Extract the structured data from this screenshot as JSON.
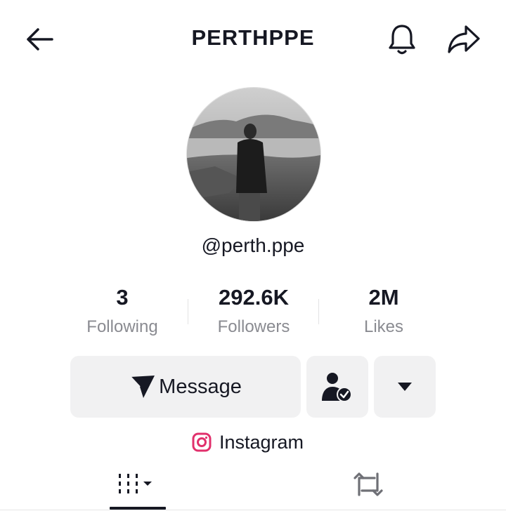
{
  "header": {
    "title": "PERTHPPE",
    "back_icon": "arrow-left-icon",
    "notification_icon": "bell-icon",
    "share_icon": "share-arrow-icon"
  },
  "profile": {
    "avatar_icon": "profile-photo",
    "handle": "@perth.ppe"
  },
  "stats": [
    {
      "value": "3",
      "label": "Following"
    },
    {
      "value": "292.6K",
      "label": "Followers"
    },
    {
      "value": "2M",
      "label": "Likes"
    }
  ],
  "actions": {
    "message_label": "Message",
    "message_icon": "paper-plane-icon",
    "friend_icon": "person-check-icon",
    "more_icon": "caret-down-icon"
  },
  "links": {
    "instagram_label": "Instagram",
    "instagram_icon": "instagram-icon",
    "instagram_color": "#E1306C"
  },
  "tabs": [
    {
      "name": "videos",
      "icon": "grid-icon",
      "active": true
    },
    {
      "name": "reposts",
      "icon": "repost-icon",
      "active": false
    }
  ]
}
